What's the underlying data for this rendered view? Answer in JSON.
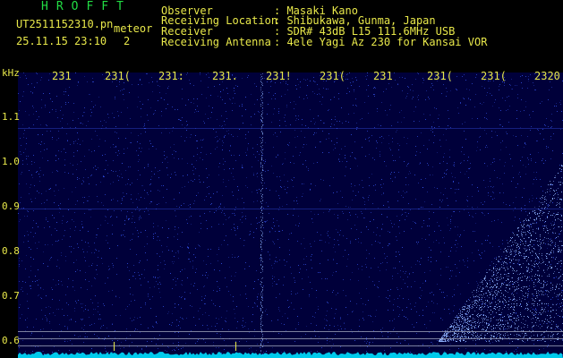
{
  "header": {
    "brand": "HROFFT",
    "file_id": "UT2511152310.pn",
    "meteor_label": "meteor",
    "timestamp": "25.11.15 23:10",
    "meteor_count": "2",
    "fields": [
      {
        "label": "Observer",
        "value": ": Masaki Kano"
      },
      {
        "label": "Receiving Location",
        "value": ": Shibukawa, Gunma, Japan"
      },
      {
        "label": "Receiver",
        "value": ": SDR# 43dB L15 111.6MHz USB"
      },
      {
        "label": "Receiving Antenna",
        "value": ": 4ele Yagi Az 230 for Kansai VOR"
      }
    ]
  },
  "axis": {
    "y_unit": "kHz",
    "y_ticks": [
      "1.1",
      "1.0",
      "0.9",
      "0.8",
      "0.7",
      "0.6"
    ],
    "x_ticks": [
      "231",
      "231(",
      "231:",
      "231.",
      "231!",
      "231(",
      "231",
      "231(",
      "231(",
      "2320"
    ]
  },
  "colors": {
    "background": "#000000",
    "header_text": "#e8e84a",
    "brand_text": "#22dd44",
    "spectrogram_bg": "#00003a",
    "noise": "#3b5cff",
    "signal": "#8fb4ff",
    "baseline": "#00e0ff"
  }
}
